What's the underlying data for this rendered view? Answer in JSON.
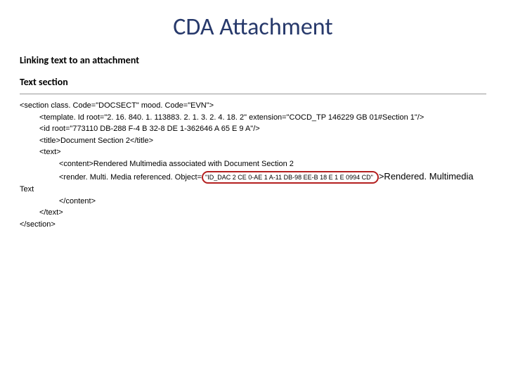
{
  "title": "CDA Attachment",
  "subhead1": "Linking text to an attachment",
  "subhead2": "Text section",
  "code": {
    "l1_a": "<section class. Code=\"DOCSECT\" mood. Code=\"EVN\">",
    "l2_a": "<template. Id root=\"2. 16. 840. 1. 113883. 2. 1. 3. 2. 4. 18. 2\" extension=\"COCD_TP 146229 GB 01#Section 1\"/>",
    "l3_a": "<id root=\"773110 DB-288 F-4 B 32-8 DE 1-362646 A 65 E 9 A\"/>",
    "l4_a": "<title>Document Section 2</title>",
    "l5_a": "<text>",
    "l6_a": "<content>Rendered Multimedia associated with Document Section 2",
    "l7_pre": "<render. Multi. Media referenced. Object=",
    "l7_hl": "\"ID_DAC 2 CE 0-AE 1 A-11 DB-98 EE-B 18 E 1 E 0994 CD\"",
    "l7_post": ">Rendered. Multimedia",
    "l8_a": "Text",
    "l9_a": "</content>",
    "l10_a": "</text>",
    "l11_a": "</section>"
  }
}
